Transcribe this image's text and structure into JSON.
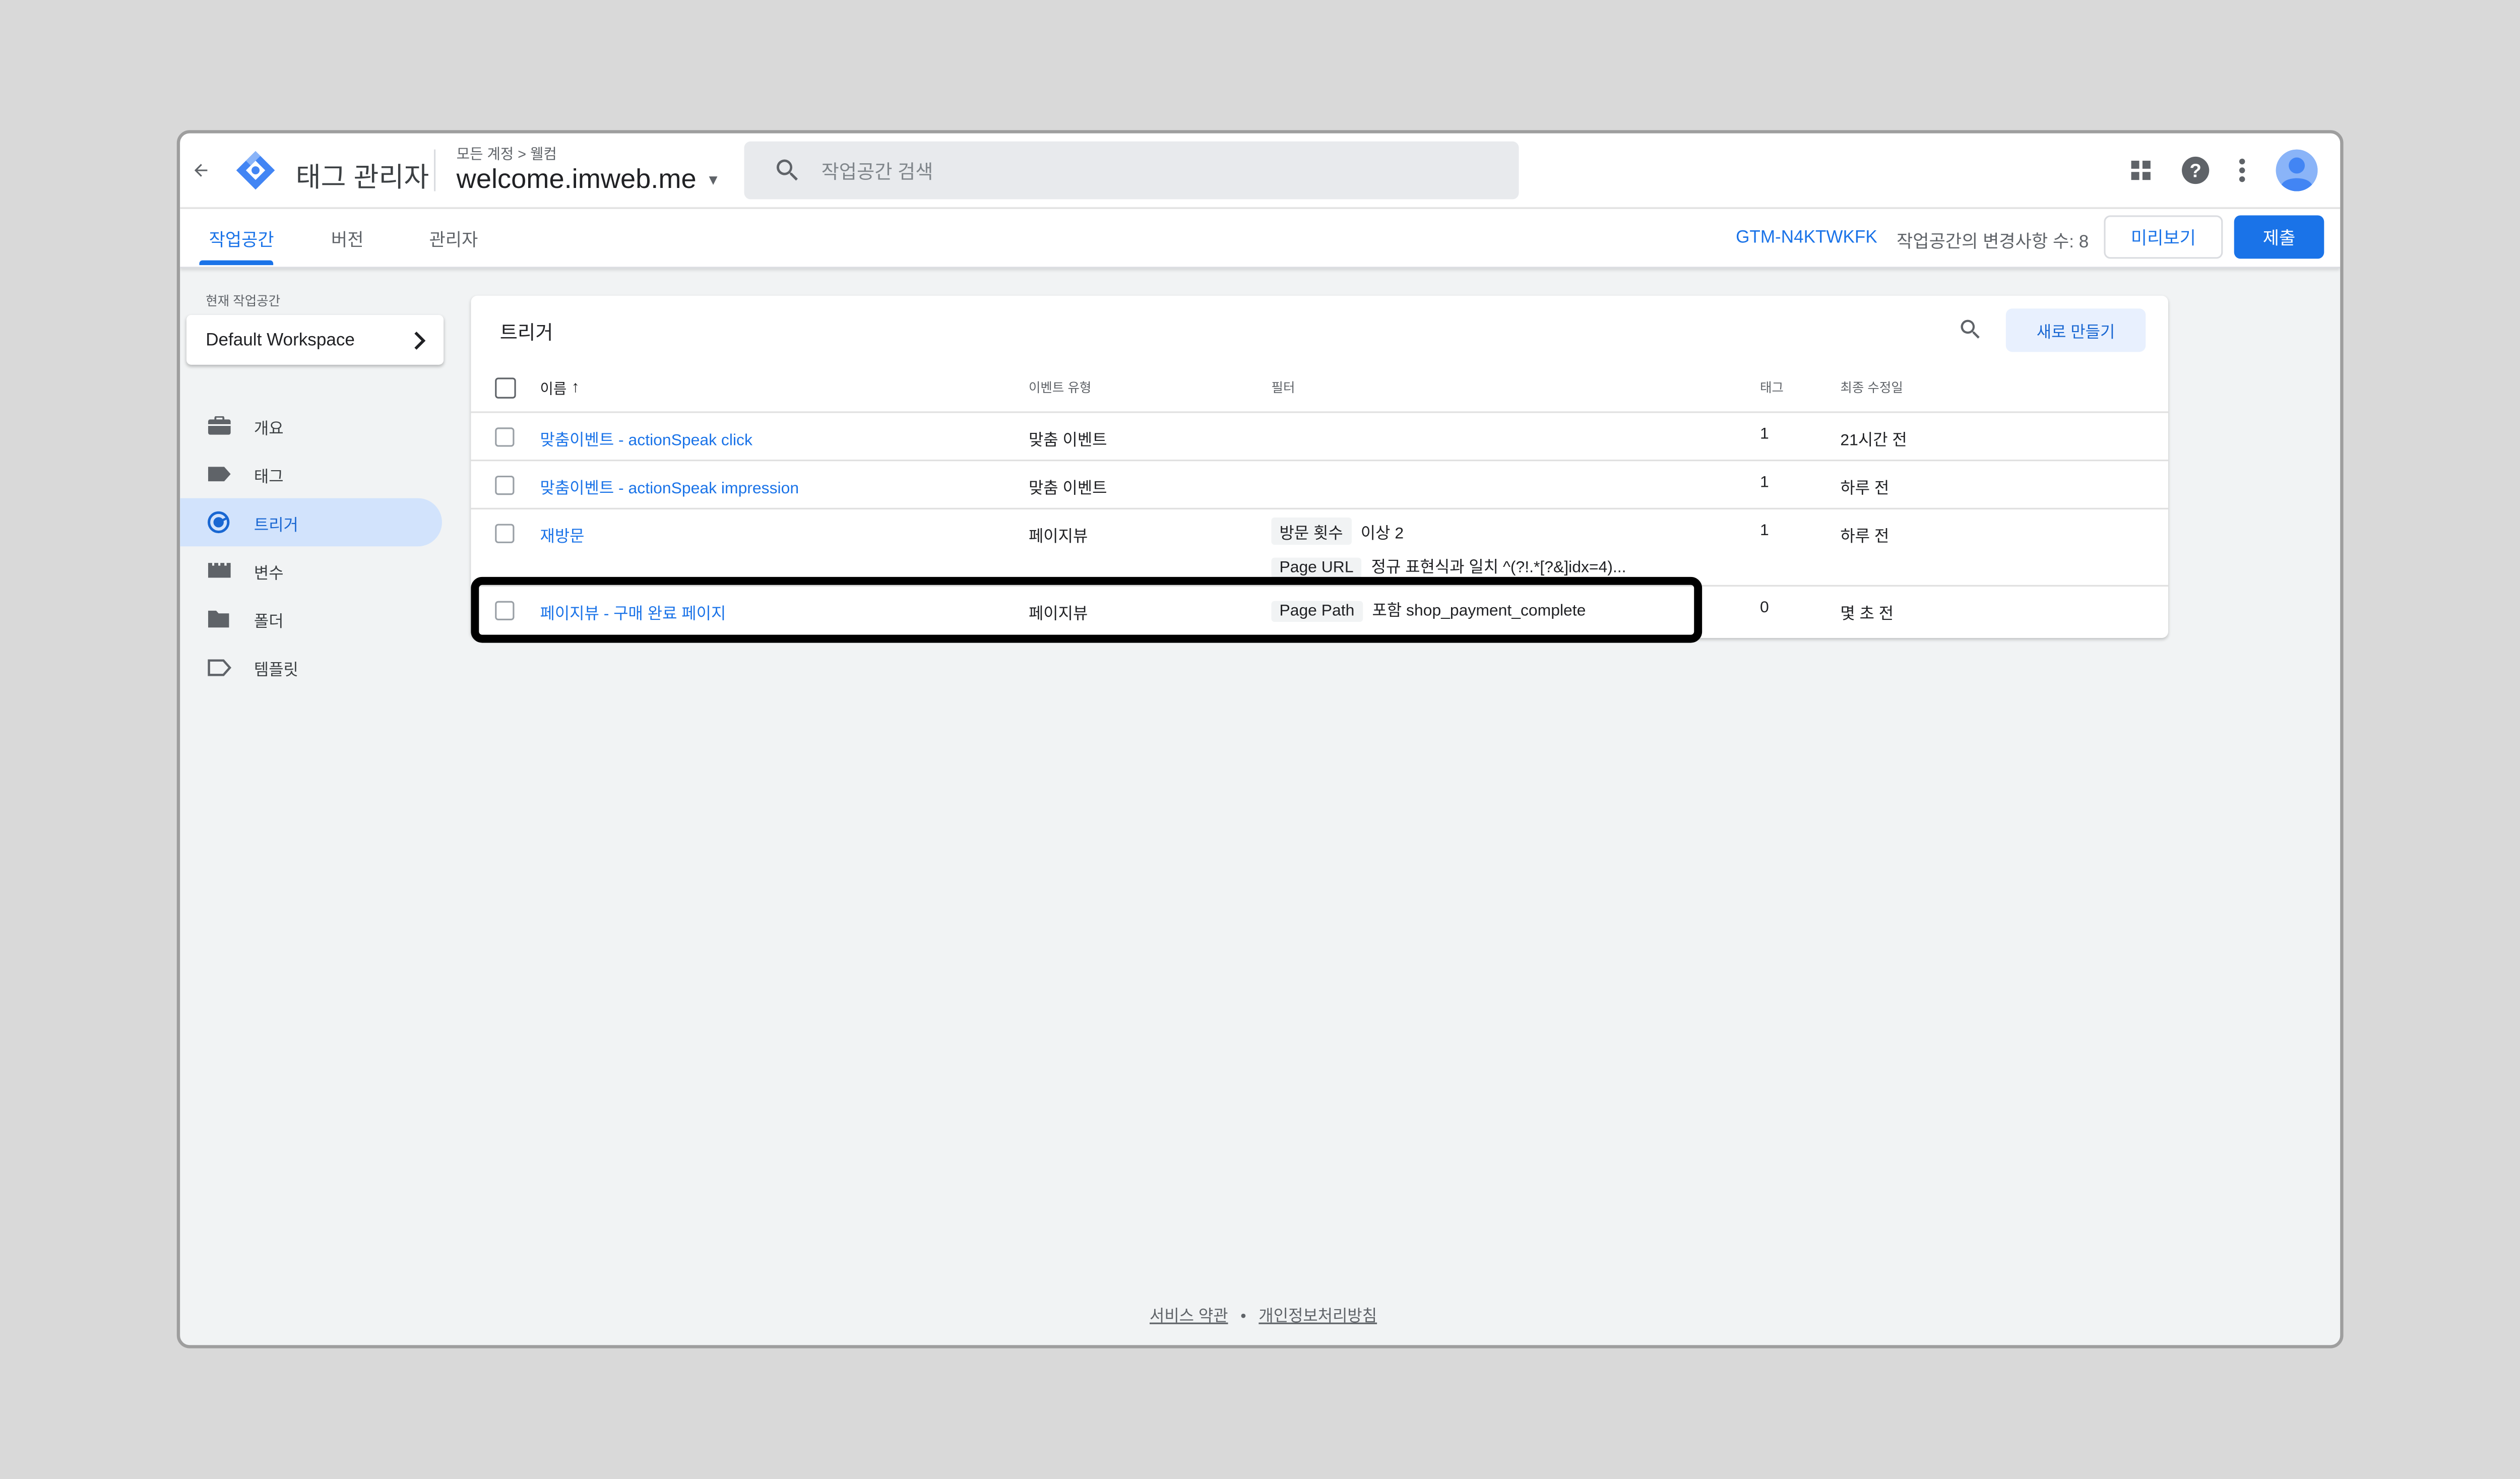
{
  "header": {
    "product_name": "태그 관리자",
    "breadcrumb": "모든 계정 > 웰컴",
    "container_name": "welcome.imweb.me",
    "search_placeholder": "작업공간 검색",
    "icons": [
      "back-arrow-icon",
      "gtm-logo-icon",
      "search-icon",
      "apps-icon",
      "help-icon",
      "more-vert-icon",
      "account-icon"
    ]
  },
  "subnav": {
    "tabs": [
      {
        "label": "작업공간",
        "active": true
      },
      {
        "label": "버전",
        "active": false
      },
      {
        "label": "관리자",
        "active": false
      }
    ],
    "container_id": "GTM-N4KTWKFK",
    "changes": "작업공간의 변경사항 수: 8",
    "preview_label": "미리보기",
    "submit_label": "제출"
  },
  "sidebar": {
    "workspace_label": "현재 작업공간",
    "workspace_name": "Default Workspace",
    "items": [
      {
        "label": "개요",
        "icon": "briefcase-icon",
        "active": false
      },
      {
        "label": "태그",
        "icon": "tag-icon",
        "active": false
      },
      {
        "label": "트리거",
        "icon": "trigger-icon",
        "active": true
      },
      {
        "label": "변수",
        "icon": "variable-icon",
        "active": false
      },
      {
        "label": "폴더",
        "icon": "folder-icon",
        "active": false
      },
      {
        "label": "템플릿",
        "icon": "template-icon",
        "active": false
      }
    ]
  },
  "triggers": {
    "title": "트리거",
    "new_label": "새로 만들기",
    "columns": {
      "name": "이름",
      "event_type": "이벤트 유형",
      "filter": "필터",
      "tags": "태그",
      "modified": "최종 수정일"
    },
    "rows": [
      {
        "name": "맞춤이벤트 - actionSpeak click",
        "event_type": "맞춤 이벤트",
        "filters": [],
        "tags": "1",
        "modified": "21시간 전"
      },
      {
        "name": "맞춤이벤트 - actionSpeak impression",
        "event_type": "맞춤 이벤트",
        "filters": [],
        "tags": "1",
        "modified": "하루 전"
      },
      {
        "name": "재방문",
        "event_type": "페이지뷰",
        "filters": [
          {
            "variable": "방문 횟수",
            "condition": "이상 2"
          },
          {
            "variable": "Page URL",
            "condition": "정규 표현식과 일치 ^(?!.*[?&]idx=4)..."
          }
        ],
        "tags": "1",
        "modified": "하루 전"
      },
      {
        "name": "페이지뷰 - 구매 완료 페이지",
        "event_type": "페이지뷰",
        "filters": [
          {
            "variable": "Page Path",
            "condition": "포함 shop_payment_complete"
          }
        ],
        "tags": "0",
        "modified": "몇 초 전",
        "highlighted": true
      }
    ]
  },
  "footer": {
    "terms": "서비스 약관",
    "separator": "•",
    "privacy": "개인정보처리방침"
  },
  "colors": {
    "accent": "#1a73e8",
    "active_nav_bg": "#d2e3fc",
    "highlight_border": "#000000"
  }
}
